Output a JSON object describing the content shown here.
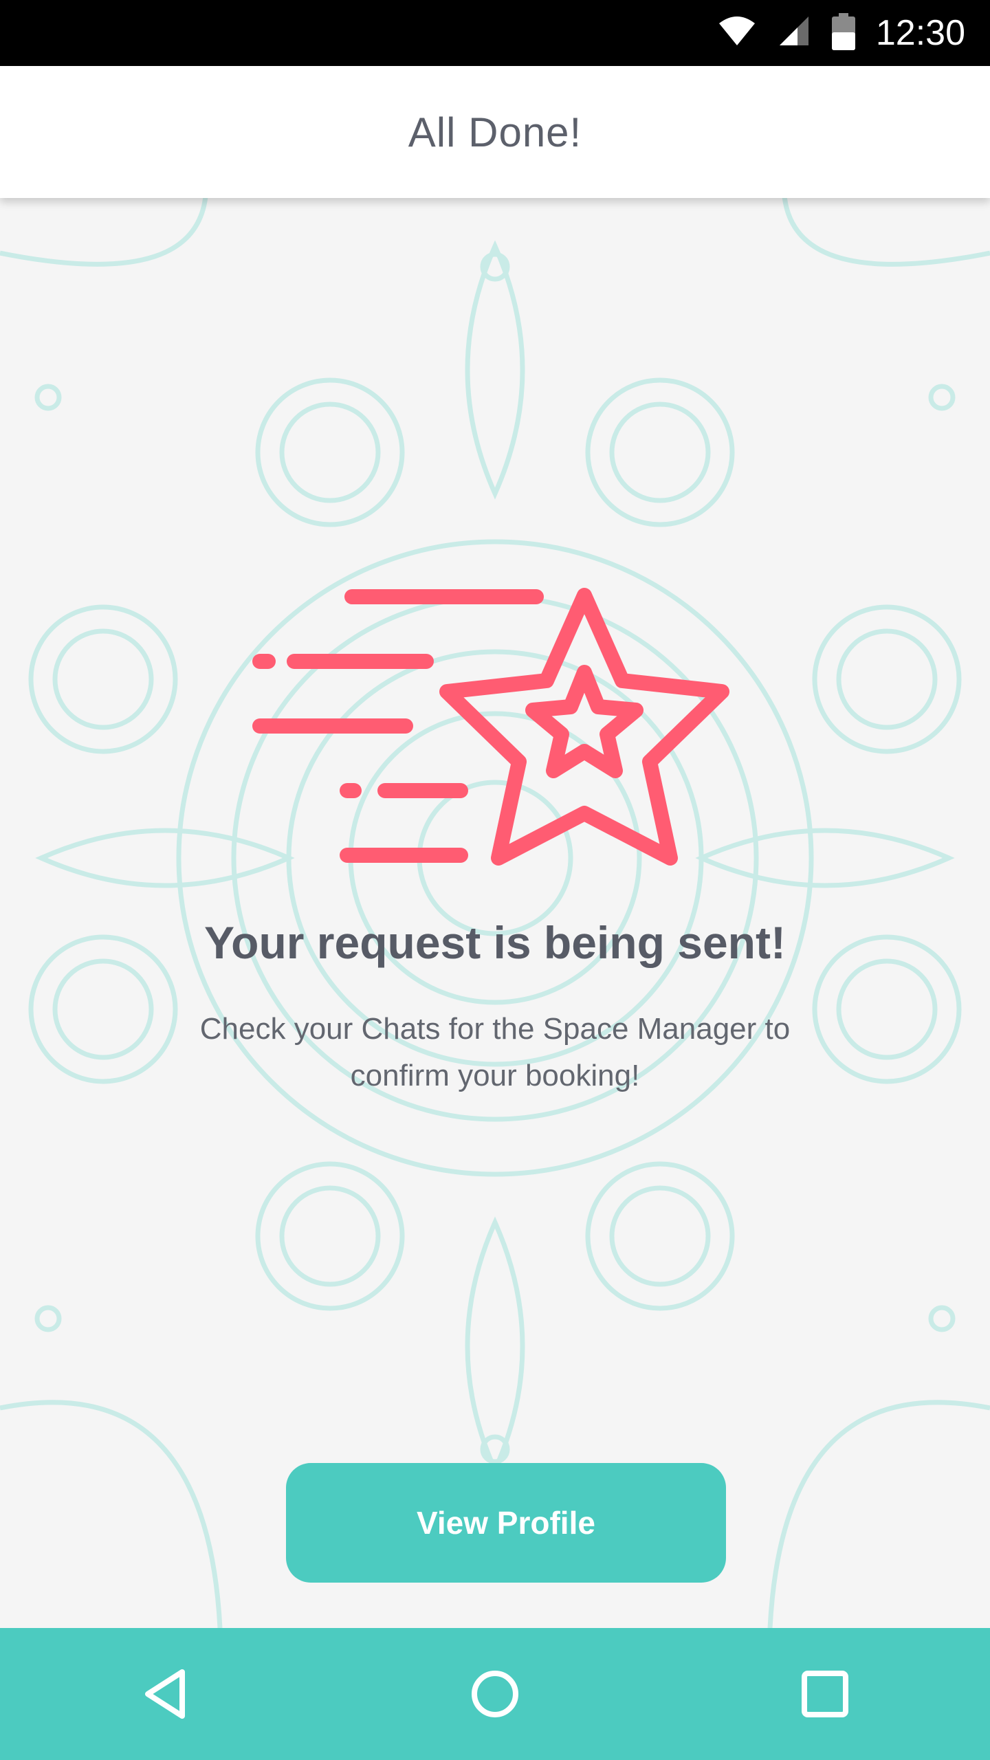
{
  "status_bar": {
    "time": "12:30",
    "icons": [
      "wifi-icon",
      "cellular-signal-icon",
      "battery-icon"
    ]
  },
  "app_bar": {
    "title": "All Done!"
  },
  "main": {
    "illustration": "star-shooting-icon",
    "headline": "Your request is being sent!",
    "message": "Check your Chats for the Space Manager to confirm your booking!",
    "primary_button_label": "View Profile"
  },
  "nav_bar": {
    "buttons": [
      "back-icon",
      "home-icon",
      "recents-icon"
    ]
  },
  "colors": {
    "accent": "#4ccbc0",
    "illustration": "#ff5c72",
    "text_primary": "#575b66",
    "background": "#f5f5f5",
    "mandala_line": "#c9ebe7"
  }
}
